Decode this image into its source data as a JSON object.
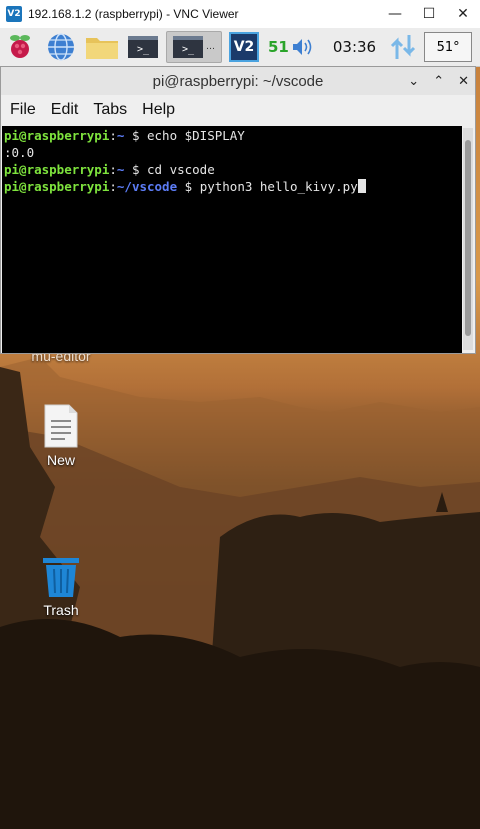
{
  "vnc_window": {
    "title": "192.168.1.2 (raspberrypi) - VNC Viewer",
    "logo_text": "V2",
    "controls": {
      "minimize": "—",
      "maximize": "☐",
      "close": "✕"
    }
  },
  "panel": {
    "cpu_usage": "51",
    "clock": "03:36",
    "temperature": "51°",
    "vnc_icon_text": "V2",
    "terminal_prompt_glyph": ">_"
  },
  "terminal": {
    "title": "pi@raspberrypi: ~/vscode",
    "menu": [
      "File",
      "Edit",
      "Tabs",
      "Help"
    ],
    "lines": [
      {
        "user": "pi@raspberrypi",
        "sep": ":",
        "path": "~",
        "prompt": " $ ",
        "cmd": "echo $DISPLAY"
      },
      {
        "output": ":0.0"
      },
      {
        "user": "pi@raspberrypi",
        "sep": ":",
        "path": "~",
        "prompt": " $ ",
        "cmd": "cd vscode"
      },
      {
        "user": "pi@raspberrypi",
        "sep": ":",
        "path": "~/vscode",
        "prompt": " $ ",
        "cmd": "python3 hello_kivy.py"
      }
    ]
  },
  "desktop": {
    "partial_label": "mu-editor",
    "icons": [
      {
        "label": "New"
      },
      {
        "label": "Trash"
      }
    ]
  },
  "colors": {
    "prompt_user": "#7ee33d",
    "prompt_path": "#5c7cf5",
    "cpu_text": "#2aa42a",
    "vnc_blue": "#1b75bb"
  }
}
